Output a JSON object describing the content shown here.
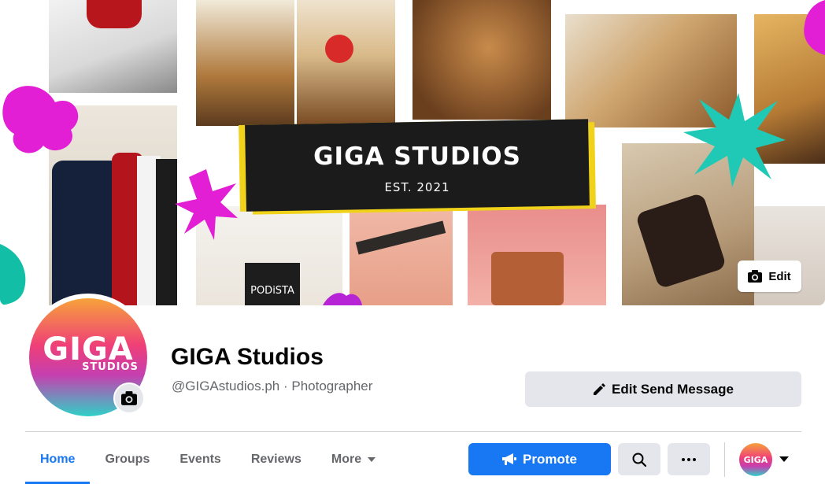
{
  "cover": {
    "banner_title": "GIGA STUDIOS",
    "banner_subtitle": "EST. 2021",
    "edit_label": "Edit",
    "product_box_label": "PODiSTA",
    "accent_colors": {
      "magenta": "#e21fd4",
      "teal": "#1fc9b5",
      "yellow": "#f1d21a"
    }
  },
  "profile": {
    "avatar_text": "GIGA",
    "avatar_subtext": "STUDIOS",
    "page_name": "GIGA Studios",
    "handle": "@GIGAstudios.ph · Photographer"
  },
  "actions": {
    "send_message_label": "Edit Send Message",
    "promote_label": "Promote",
    "mini_avatar_text": "GIGA"
  },
  "tabs": [
    {
      "label": "Home",
      "active": true
    },
    {
      "label": "Groups"
    },
    {
      "label": "Events"
    },
    {
      "label": "Reviews"
    },
    {
      "label": "More"
    }
  ],
  "colors": {
    "accent": "#1877f2",
    "secondary_button": "#e4e6eb",
    "muted_text": "#65676b"
  }
}
